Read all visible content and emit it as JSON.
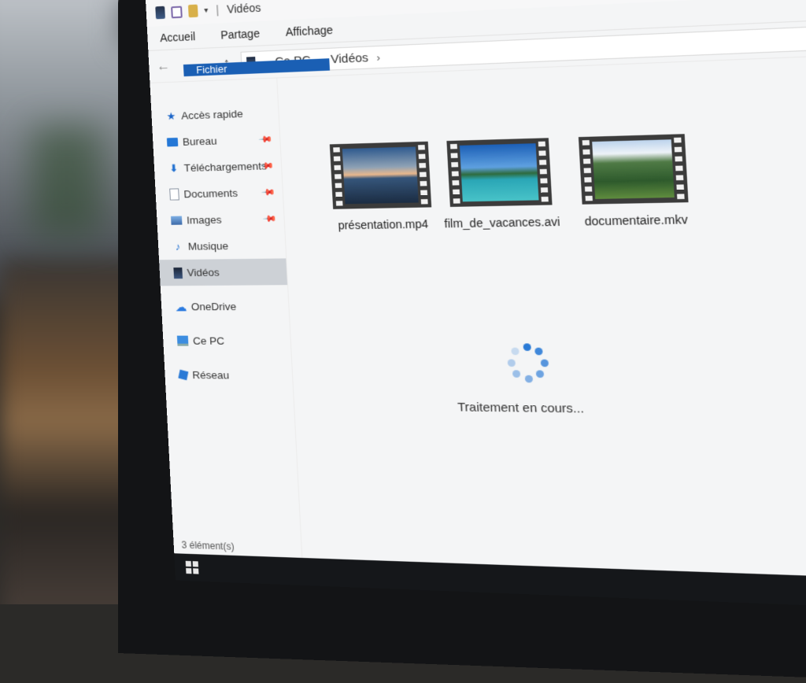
{
  "window": {
    "title": "Vidéos",
    "title_separator": "|"
  },
  "ribbon": {
    "tabs": [
      {
        "label": "Fichier",
        "active": true
      },
      {
        "label": "Accueil"
      },
      {
        "label": "Partage"
      },
      {
        "label": "Affichage"
      }
    ]
  },
  "navigation": {
    "back_icon": "←",
    "forward_icon": "→",
    "recent_icon": "⌄",
    "up_icon": "↑"
  },
  "address": {
    "separator": "›",
    "crumbs": [
      "Ce PC",
      "Vidéos"
    ]
  },
  "sidebar": {
    "items": [
      {
        "label": "Accès rapide",
        "icon": "star-icon",
        "pinned": false
      },
      {
        "label": "Bureau",
        "icon": "desktop-icon",
        "pinned": true
      },
      {
        "label": "Téléchargements",
        "icon": "download-icon",
        "pinned": true
      },
      {
        "label": "Documents",
        "icon": "document-icon",
        "pinned": true
      },
      {
        "label": "Images",
        "icon": "image-icon",
        "pinned": true
      },
      {
        "label": "Musique",
        "icon": "music-icon",
        "pinned": false
      },
      {
        "label": "Vidéos",
        "icon": "video-icon",
        "pinned": false,
        "selected": true
      },
      {
        "label": "OneDrive",
        "icon": "cloud-icon"
      },
      {
        "label": "Ce PC",
        "icon": "computer-icon"
      },
      {
        "label": "Réseau",
        "icon": "network-icon"
      }
    ],
    "pin_glyph": "📌"
  },
  "files": [
    {
      "name": "présentation.mp4",
      "thumbnail": "sunset-lake"
    },
    {
      "name": "film_de_vacances.avi",
      "thumbnail": "tropical-beach"
    },
    {
      "name": "documentaire.mkv",
      "thumbnail": "green-valley"
    }
  ],
  "status": {
    "loading_text": "Traitement en cours...",
    "item_count": "3 élément(s)"
  },
  "colors": {
    "accent": "#1a5fb4",
    "spinner": "#2a7ad6",
    "selected_bg": "#cdd1d6"
  }
}
